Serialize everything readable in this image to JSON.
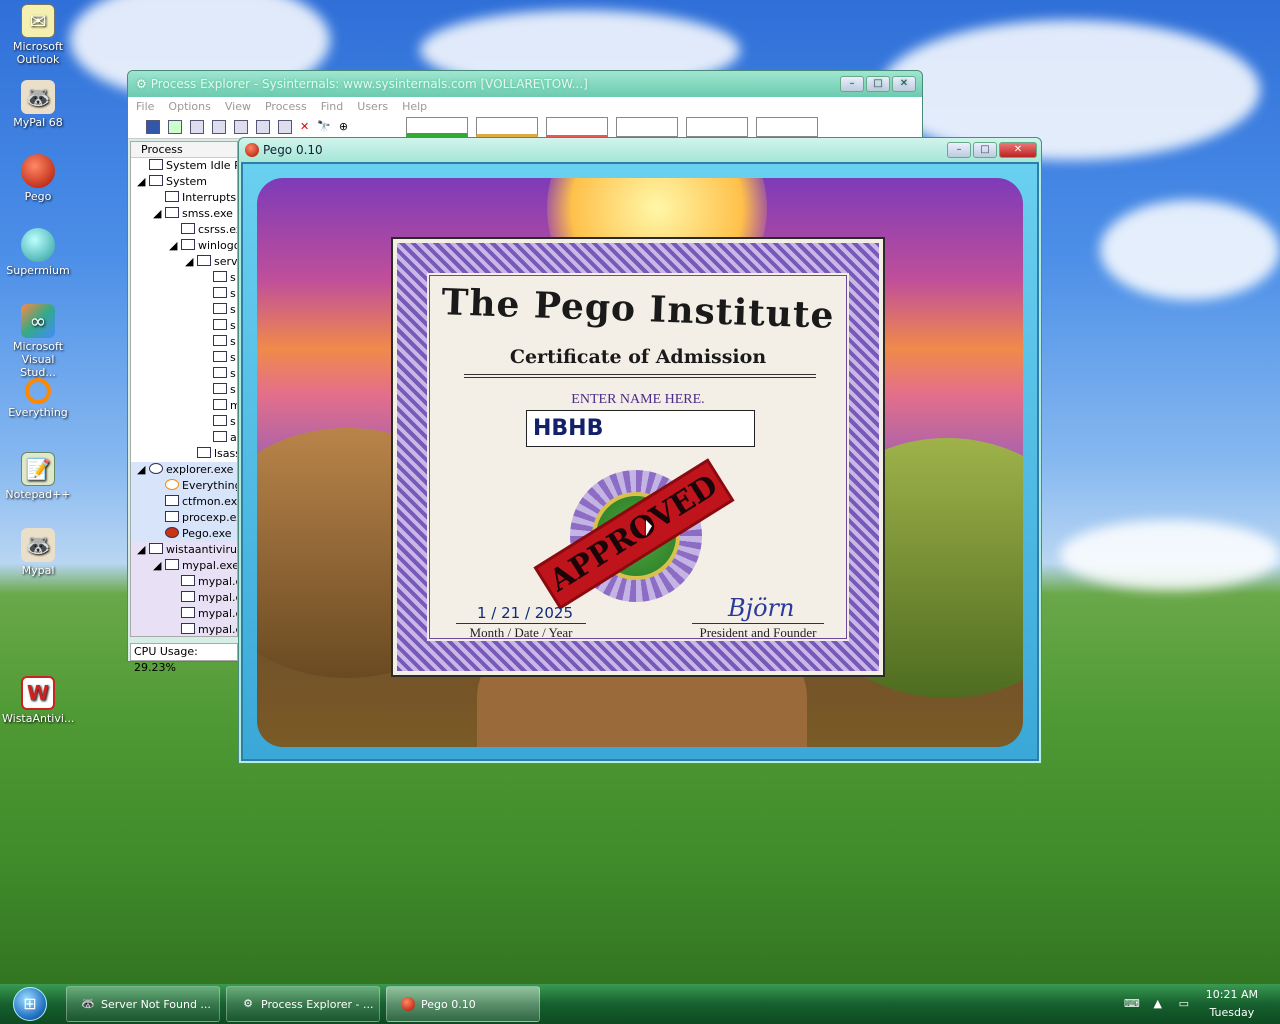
{
  "desktop": {
    "icons": [
      {
        "label": "Microsoft Outlook",
        "icon": "outlook-icon"
      },
      {
        "label": "MyPal 68",
        "icon": "mypal-icon"
      },
      {
        "label": "Pego",
        "icon": "pego-icon"
      },
      {
        "label": "Supermium",
        "icon": "supermium-icon"
      },
      {
        "label": "Microsoft Visual Stud...",
        "icon": "visual-studio-icon"
      },
      {
        "label": "Everything",
        "icon": "everything-icon"
      },
      {
        "label": "Notepad++",
        "icon": "notepadpp-icon"
      },
      {
        "label": "Mypal",
        "icon": "mypal-icon"
      },
      {
        "label": "WistaAntivi...",
        "icon": "antivirus-icon"
      }
    ]
  },
  "process_explorer": {
    "title": "Process Explorer - Sysinternals: www.sysinternals.com [VOLLARE\\TOW...]",
    "menu": [
      "File",
      "Options",
      "View",
      "Process",
      "Find",
      "Users",
      "Help"
    ],
    "column_header": "Process",
    "rows": [
      "System Idle Pro",
      "System",
      "Interrupts",
      "smss.exe",
      "csrss.ex",
      "winlogon",
      "servi",
      "s",
      "s",
      "s",
      "s",
      "s",
      "s",
      "s",
      "s",
      "m",
      "s",
      "a",
      "lsass",
      "explorer.exe",
      "Everything.",
      "ctfmon.exe",
      "procexp.ex",
      "Pego.exe",
      "wistaantivirus.e",
      "mypal.exe",
      "mypal.ex",
      "mypal.ex",
      "mypal.ex",
      "mypal.ex"
    ],
    "status": "CPU Usage: 29.23%"
  },
  "pego": {
    "title": "Pego 0.10",
    "certificate": {
      "title": "The Pego Institute",
      "subtitle": "Certificate of Admission",
      "prompt": "ENTER NAME HERE.",
      "name_value": "HBHB",
      "stamp": "APPROVED",
      "date": "1 / 21 / 2025",
      "date_label": "Month / Date / Year",
      "signature": "Björn",
      "signature_label": "President and Founder"
    }
  },
  "taskbar": {
    "tasks": [
      {
        "label": "Server Not Found ...",
        "icon": "mypal-icon"
      },
      {
        "label": "Process Explorer - ...",
        "icon": "process-explorer-icon"
      },
      {
        "label": "Pego 0.10",
        "icon": "pego-icon"
      }
    ],
    "clock_time": "10:21 AM",
    "clock_day": "Tuesday"
  },
  "colors": {
    "taskbar": "#16602e",
    "pego_frame": "#3aa8d8",
    "stamp": "#c0141c",
    "cert_border": "#8a6ac2"
  }
}
